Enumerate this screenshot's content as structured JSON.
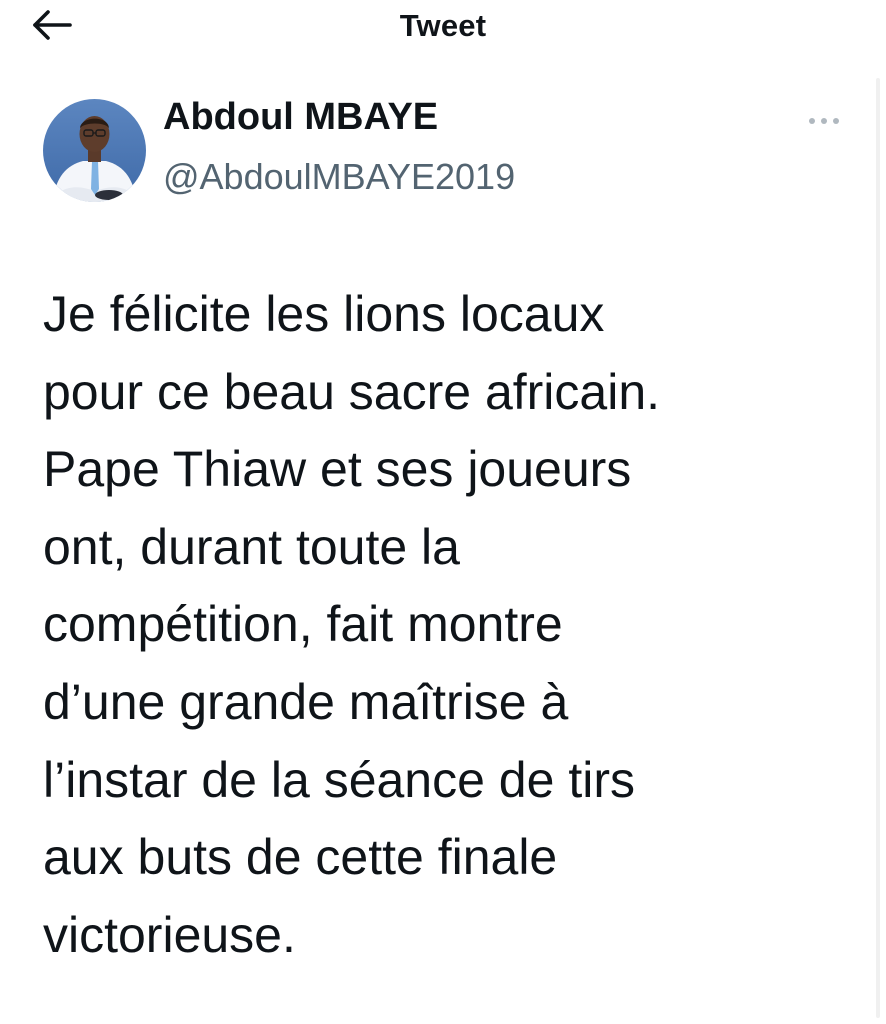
{
  "header": {
    "title": "Tweet",
    "back_icon": "arrow-left-icon"
  },
  "author": {
    "display_name": "Abdoul MBAYE",
    "handle": "@AbdoulMBAYE2019",
    "avatar": "profile-photo"
  },
  "more_icon": "ellipsis-icon",
  "tweet": {
    "lines": [
      "Je félicite les lions locaux",
      "pour ce beau sacre africain.",
      "Pape Thiaw et ses joueurs",
      "ont, durant toute la",
      "compétition, fait montre",
      "d’une grande maîtrise à",
      "l’instar de la séance de tirs",
      "aux buts de cette finale",
      "victorieuse."
    ]
  },
  "colors": {
    "text": "#0f1419",
    "secondary_text": "#536471",
    "more_dots": "#b0b8bf",
    "background": "#ffffff"
  }
}
